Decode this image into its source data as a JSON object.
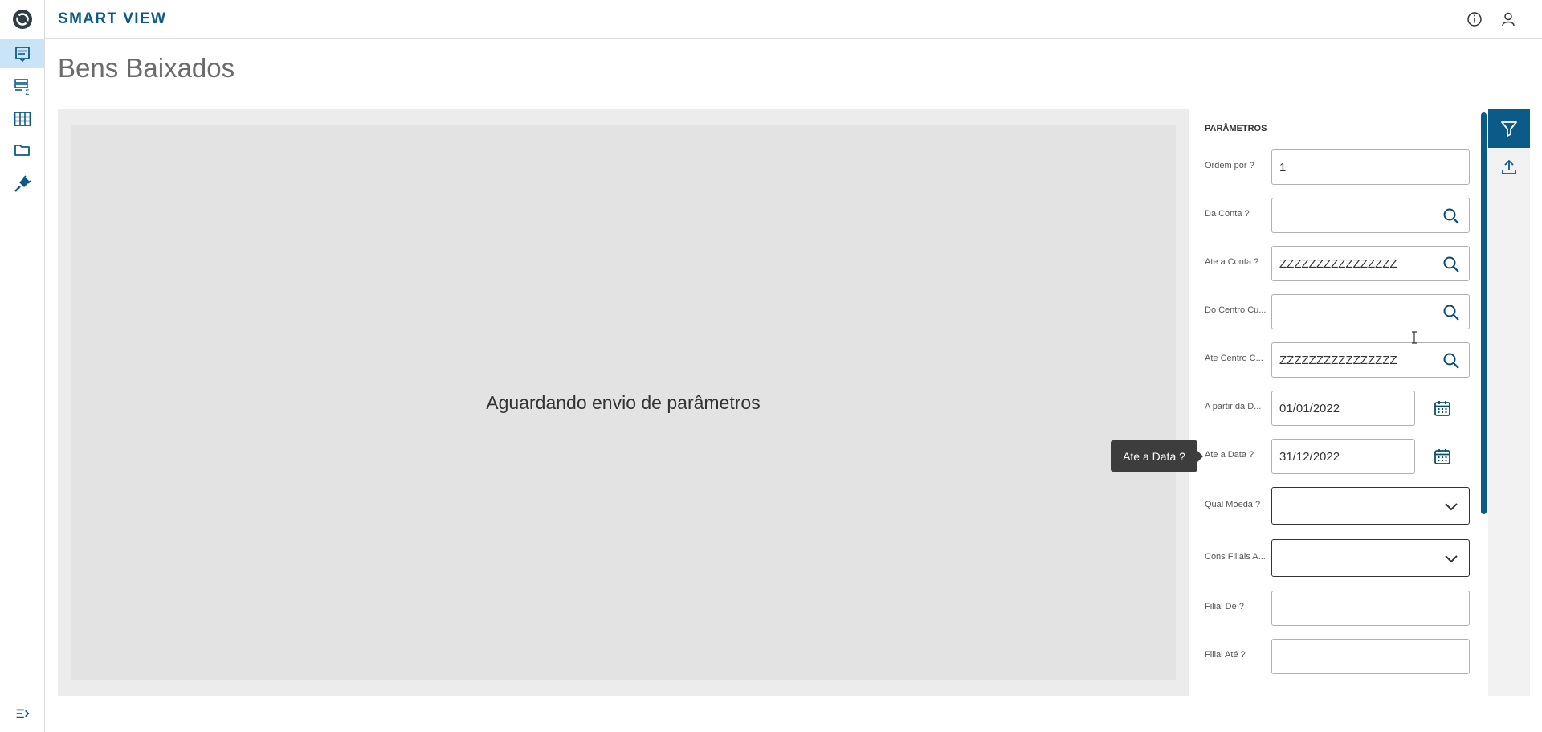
{
  "app": {
    "title": "SMART VIEW"
  },
  "page": {
    "title": "Bens Baixados",
    "waiting_message": "Aguardando envio de parâmetros"
  },
  "colors": {
    "brand": "#0c5a87",
    "active_sidebar_bg": "#c9e4f7",
    "content_bg": "#e3e3e3"
  },
  "sidebar": {
    "items": [
      {
        "name": "reports",
        "icon": "report-icon",
        "active": true
      },
      {
        "name": "sum-reports",
        "icon": "sum-list-icon",
        "active": false
      },
      {
        "name": "tables",
        "icon": "table-icon",
        "active": false
      },
      {
        "name": "folders",
        "icon": "folder-icon",
        "active": false
      },
      {
        "name": "plugins",
        "icon": "plug-icon",
        "active": false
      }
    ],
    "bottom_icon": "expand-menu-icon"
  },
  "header": {
    "icons": [
      "info-icon",
      "user-icon"
    ]
  },
  "params": {
    "title": "PARÂMETROS",
    "fields": [
      {
        "label": "Ordem por ?",
        "value": "1",
        "type": "text"
      },
      {
        "label": "Da Conta ?",
        "value": "",
        "type": "lookup"
      },
      {
        "label": "Ate a Conta ?",
        "value": "ZZZZZZZZZZZZZZZZ",
        "type": "lookup"
      },
      {
        "label": "Do Centro Cu...",
        "value": "",
        "type": "lookup"
      },
      {
        "label": "Ate Centro C...",
        "value": "ZZZZZZZZZZZZZZZZ",
        "type": "lookup"
      },
      {
        "label": "A partir da D...",
        "value": "01/01/2022",
        "type": "date"
      },
      {
        "label": "Ate a Data ?",
        "value": "31/12/2022",
        "type": "date"
      },
      {
        "label": "Qual Moeda ?",
        "value": "",
        "type": "select"
      },
      {
        "label": "Cons Filiais A...",
        "value": "",
        "type": "select"
      },
      {
        "label": "Filial De ?",
        "value": "",
        "type": "text"
      },
      {
        "label": "Filial Até ?",
        "value": "",
        "type": "text"
      }
    ]
  },
  "tooltip": {
    "text": "Ate a Data ?"
  },
  "rightbar": {
    "icons": [
      "filter-icon",
      "export-icon"
    ]
  }
}
